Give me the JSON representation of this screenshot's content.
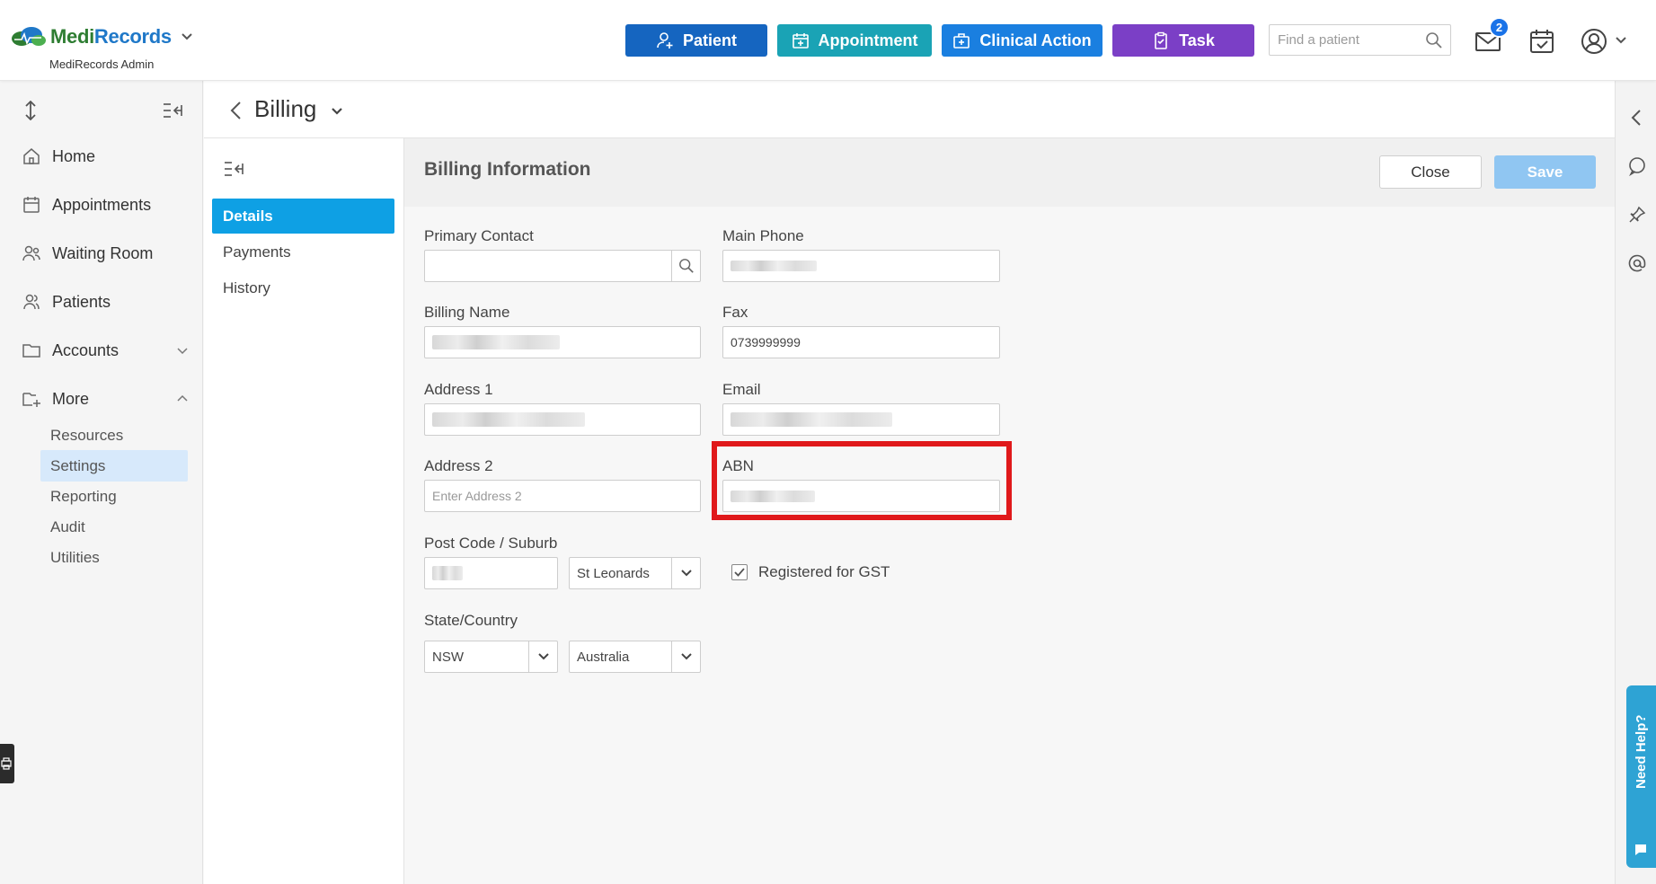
{
  "brand": {
    "name_part1": "Medi",
    "name_part2": "Records",
    "subtitle": "MediRecords Admin"
  },
  "quick_actions": {
    "patient": "Patient",
    "appointment": "Appointment",
    "clinical_action": "Clinical Action",
    "task": "Task"
  },
  "search": {
    "placeholder": "Find a patient"
  },
  "header": {
    "mail_badge": "2"
  },
  "sidebar": {
    "items": [
      {
        "label": "Home",
        "icon": "home-icon"
      },
      {
        "label": "Appointments",
        "icon": "calendar-icon"
      },
      {
        "label": "Waiting Room",
        "icon": "people-icon"
      },
      {
        "label": "Patients",
        "icon": "users-icon"
      },
      {
        "label": "Accounts",
        "icon": "folder-icon"
      },
      {
        "label": "More",
        "icon": "folder-plus-icon"
      }
    ],
    "more_subitems": [
      "Resources",
      "Settings",
      "Reporting",
      "Audit",
      "Utilities"
    ],
    "active_subitem": "Settings"
  },
  "page": {
    "title": "Billing"
  },
  "subnav": {
    "items": [
      "Details",
      "Payments",
      "History"
    ],
    "active": "Details"
  },
  "main": {
    "title": "Billing Information",
    "close_label": "Close",
    "save_label": "Save"
  },
  "form": {
    "primary_contact": {
      "label": "Primary Contact",
      "value": ""
    },
    "main_phone": {
      "label": "Main Phone"
    },
    "billing_name": {
      "label": "Billing Name"
    },
    "fax": {
      "label": "Fax",
      "value": "0739999999"
    },
    "address1": {
      "label": "Address 1"
    },
    "email": {
      "label": "Email"
    },
    "address2": {
      "label": "Address 2",
      "placeholder": "Enter Address 2"
    },
    "abn": {
      "label": "ABN"
    },
    "postcode_suburb": {
      "label": "Post Code / Suburb",
      "suburb": "St Leonards"
    },
    "gst": {
      "label": "Registered for GST",
      "checked": true
    },
    "state_country": {
      "label": "State/Country",
      "state": "NSW",
      "country": "Australia"
    }
  },
  "help": {
    "label": "Need Help?"
  },
  "colors": {
    "patient_btn": "#1565c0",
    "appointment_btn": "#1aa3b5",
    "clinical_btn": "#1a7fe0",
    "task_btn": "#7b3fc6",
    "active_tab": "#0ea0e4",
    "save_btn": "#90c6f2",
    "highlight": "#e0191b"
  }
}
